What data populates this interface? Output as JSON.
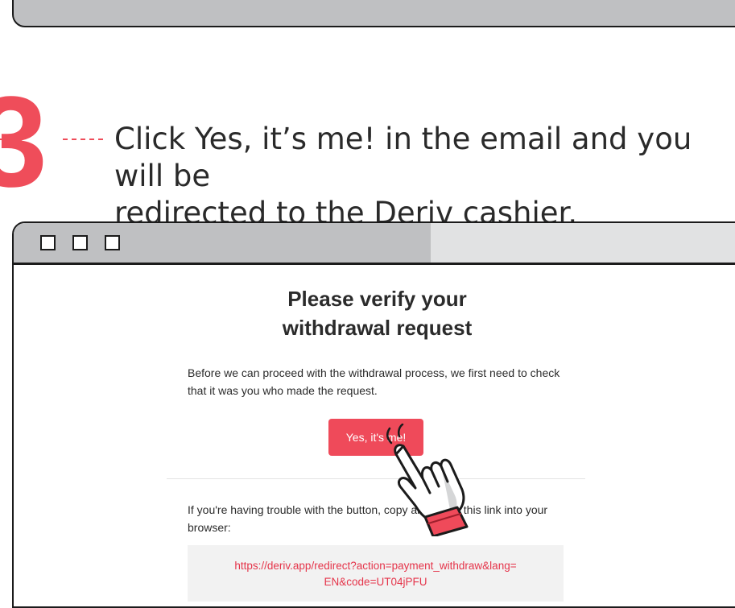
{
  "step": {
    "number": "3",
    "instruction_line1": "Click Yes, it’s me! in the email and you will be",
    "instruction_line2": "redirected to the Deriv cashier."
  },
  "email": {
    "title_line1": "Please verify your",
    "title_line2": "withdrawal request",
    "intro_line1": "Before we can proceed with the withdrawal process, we first need to check",
    "intro_line2": "that it was you who made the request.",
    "confirm_button": "Yes, it's me!",
    "trouble_line1": "If you're having trouble with the button, copy and paste this link into your",
    "trouble_line2": "browser:",
    "link_line1": "https://deriv.app/redirect?action=payment_withdraw&lang=",
    "link_line2": "EN&code=UT04jPFU"
  },
  "colors": {
    "accent": "#ef4a5a",
    "titlebar": "#bfc0c2",
    "titlebar_light": "#e1e2e3",
    "link": "#e5344a"
  },
  "icons": [
    "window-button-icon",
    "hand-pointer-icon"
  ]
}
